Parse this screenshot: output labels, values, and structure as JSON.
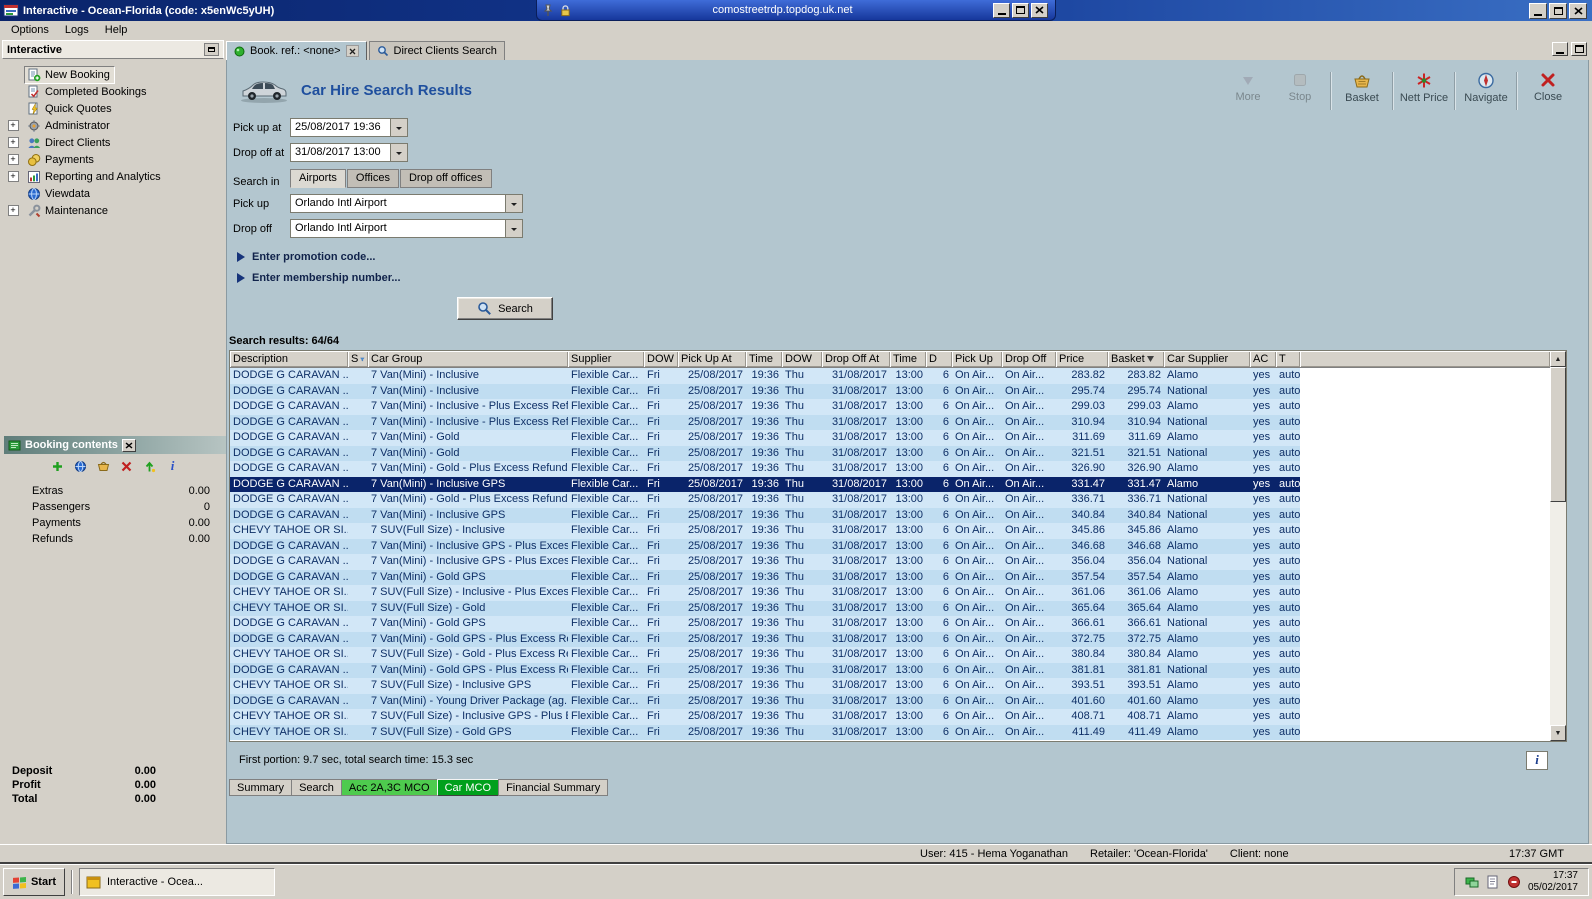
{
  "titlebar": {
    "title": "Interactive - Ocean-Florida (code: x5enWc5yUH)"
  },
  "rdp_bar": {
    "title": "comostreetrdp.topdog.uk.net"
  },
  "menu": {
    "items": [
      "Options",
      "Logs",
      "Help"
    ]
  },
  "sidebar": {
    "title": "Interactive",
    "items": [
      {
        "label": "New Booking"
      },
      {
        "label": "Completed Bookings"
      },
      {
        "label": "Quick Quotes"
      },
      {
        "label": "Administrator"
      },
      {
        "label": "Direct Clients"
      },
      {
        "label": "Payments"
      },
      {
        "label": "Reporting and Analytics"
      },
      {
        "label": "Viewdata"
      },
      {
        "label": "Maintenance"
      }
    ]
  },
  "booking_panel": {
    "title": "Booking contents",
    "rows": [
      {
        "label": "Extras",
        "value": "0.00"
      },
      {
        "label": "Passengers",
        "value": "0"
      },
      {
        "label": "Payments",
        "value": "0.00"
      },
      {
        "label": "Refunds",
        "value": "0.00"
      }
    ],
    "totals": [
      {
        "label": "Deposit",
        "value": "0.00"
      },
      {
        "label": "Profit",
        "value": "0.00"
      },
      {
        "label": "Total",
        "value": "0.00"
      }
    ]
  },
  "tabs": {
    "booking_tab": "Book. ref.: <none>",
    "clients_tab": "Direct Clients Search"
  },
  "main": {
    "title": "Car Hire Search Results",
    "toolbar": [
      {
        "label": "More"
      },
      {
        "label": "Stop"
      },
      {
        "label": "Basket"
      },
      {
        "label": "Nett Price"
      },
      {
        "label": "Navigate"
      },
      {
        "label": "Close"
      }
    ],
    "form": {
      "pickup_at": {
        "label": "Pick up at",
        "value": "25/08/2017 19:36"
      },
      "dropoff_at": {
        "label": "Drop off at",
        "value": "31/08/2017 13:00"
      },
      "search_in_label": "Search in",
      "search_in_tabs": [
        "Airports",
        "Offices",
        "Drop off offices"
      ],
      "pickup": {
        "label": "Pick up",
        "value": "Orlando Intl Airport"
      },
      "dropoff": {
        "label": "Drop off",
        "value": "Orlando Intl Airport"
      },
      "promo": "Enter promotion code...",
      "membership": "Enter membership number...",
      "search_button": "Search"
    },
    "results_label": "Search results: 64/64",
    "table": {
      "columns": [
        "Description",
        "S",
        "Car Group",
        "Supplier",
        "DOW",
        "Pick Up At",
        "Time",
        "DOW",
        "Drop Off At",
        "Time",
        "D",
        "Pick Up",
        "Drop Off",
        "Price",
        "Basket",
        "Car Supplier",
        "AC",
        "T"
      ],
      "row_common": {
        "supplier": "Flexible Car...",
        "dow1": "Fri",
        "pu_date": "25/08/2017",
        "pu_time": "19:36",
        "dow2": "Thu",
        "do_date": "31/08/2017",
        "do_time": "13:00",
        "days": "6",
        "pu_loc": "On Air...",
        "do_loc": "On Air...",
        "ac": "yes",
        "t": "auto"
      },
      "rows": [
        {
          "desc": "DODGE G CARAVAN ...",
          "group": "7 Van(Mini) - Inclusive",
          "price": "283.82",
          "basket": "283.82",
          "car_supplier": "Alamo"
        },
        {
          "desc": "DODGE G CARAVAN ...",
          "group": "7 Van(Mini) - Inclusive",
          "price": "295.74",
          "basket": "295.74",
          "car_supplier": "National"
        },
        {
          "desc": "DODGE G CARAVAN ...",
          "group": "7 Van(Mini) - Inclusive - Plus Excess Ref...",
          "price": "299.03",
          "basket": "299.03",
          "car_supplier": "Alamo"
        },
        {
          "desc": "DODGE G CARAVAN ...",
          "group": "7 Van(Mini) - Inclusive - Plus Excess Ref...",
          "price": "310.94",
          "basket": "310.94",
          "car_supplier": "National"
        },
        {
          "desc": "DODGE G CARAVAN ...",
          "group": "7 Van(Mini) - Gold",
          "price": "311.69",
          "basket": "311.69",
          "car_supplier": "Alamo"
        },
        {
          "desc": "DODGE G CARAVAN ...",
          "group": "7 Van(Mini) - Gold",
          "price": "321.51",
          "basket": "321.51",
          "car_supplier": "National"
        },
        {
          "desc": "DODGE G CARAVAN ...",
          "group": "7 Van(Mini) - Gold - Plus Excess Refund",
          "price": "326.90",
          "basket": "326.90",
          "car_supplier": "Alamo"
        },
        {
          "desc": "DODGE G CARAVAN ...",
          "group": "7 Van(Mini) - Inclusive GPS",
          "price": "331.47",
          "basket": "331.47",
          "car_supplier": "Alamo",
          "selected": true
        },
        {
          "desc": "DODGE G CARAVAN ...",
          "group": "7 Van(Mini) - Gold - Plus Excess Refund",
          "price": "336.71",
          "basket": "336.71",
          "car_supplier": "National"
        },
        {
          "desc": "DODGE G CARAVAN ...",
          "group": "7 Van(Mini) - Inclusive GPS",
          "price": "340.84",
          "basket": "340.84",
          "car_supplier": "National"
        },
        {
          "desc": "CHEVY TAHOE OR SI...",
          "group": "7 SUV(Full Size) - Inclusive",
          "price": "345.86",
          "basket": "345.86",
          "car_supplier": "Alamo"
        },
        {
          "desc": "DODGE G CARAVAN ...",
          "group": "7 Van(Mini) - Inclusive GPS - Plus Exces...",
          "price": "346.68",
          "basket": "346.68",
          "car_supplier": "Alamo"
        },
        {
          "desc": "DODGE G CARAVAN ...",
          "group": "7 Van(Mini) - Inclusive GPS - Plus Exces...",
          "price": "356.04",
          "basket": "356.04",
          "car_supplier": "National"
        },
        {
          "desc": "DODGE G CARAVAN ...",
          "group": "7 Van(Mini) - Gold GPS",
          "price": "357.54",
          "basket": "357.54",
          "car_supplier": "Alamo"
        },
        {
          "desc": "CHEVY TAHOE OR SI...",
          "group": "7 SUV(Full Size) - Inclusive - Plus Excess...",
          "price": "361.06",
          "basket": "361.06",
          "car_supplier": "Alamo"
        },
        {
          "desc": "CHEVY TAHOE OR SI...",
          "group": "7 SUV(Full Size) - Gold",
          "price": "365.64",
          "basket": "365.64",
          "car_supplier": "Alamo"
        },
        {
          "desc": "DODGE G CARAVAN ...",
          "group": "7 Van(Mini) - Gold GPS",
          "price": "366.61",
          "basket": "366.61",
          "car_supplier": "National"
        },
        {
          "desc": "DODGE G CARAVAN ...",
          "group": "7 Van(Mini) - Gold GPS - Plus Excess Ref...",
          "price": "372.75",
          "basket": "372.75",
          "car_supplier": "Alamo"
        },
        {
          "desc": "CHEVY TAHOE OR SI...",
          "group": "7 SUV(Full Size) - Gold - Plus Excess Ref...",
          "price": "380.84",
          "basket": "380.84",
          "car_supplier": "Alamo"
        },
        {
          "desc": "DODGE G CARAVAN ...",
          "group": "7 Van(Mini) - Gold GPS - Plus Excess Ref...",
          "price": "381.81",
          "basket": "381.81",
          "car_supplier": "National"
        },
        {
          "desc": "CHEVY TAHOE OR SI...",
          "group": "7 SUV(Full Size) - Inclusive GPS",
          "price": "393.51",
          "basket": "393.51",
          "car_supplier": "Alamo"
        },
        {
          "desc": "DODGE G CARAVAN ...",
          "group": "7 Van(Mini) - Young Driver Package (ag...",
          "price": "401.60",
          "basket": "401.60",
          "car_supplier": "Alamo"
        },
        {
          "desc": "CHEVY TAHOE OR SI...",
          "group": "7 SUV(Full Size) - Inclusive GPS - Plus E...",
          "price": "408.71",
          "basket": "408.71",
          "car_supplier": "Alamo"
        },
        {
          "desc": "CHEVY TAHOE OR SI...",
          "group": "7 SUV(Full Size) - Gold GPS",
          "price": "411.49",
          "basket": "411.49",
          "car_supplier": "Alamo"
        }
      ]
    },
    "status_text": "First portion: 9.7 sec, total search time: 15.3 sec",
    "bottom_tabs": [
      "Summary",
      "Search",
      "Acc 2A,3C MCO",
      "Car MCO",
      "Financial Summary"
    ]
  },
  "statusbar": {
    "user": "User: 415 - Hema Yoganathan",
    "retailer": "Retailer: 'Ocean-Florida'",
    "client": "Client: none",
    "time": "17:37 GMT"
  },
  "taskbar": {
    "start": "Start",
    "task": "Interactive - Ocea...",
    "clock_time": "17:37",
    "clock_date": "05/02/2017"
  },
  "colors": {
    "selected_row": "#0a246a",
    "row_stripe_light": "#d2e7f7",
    "row_stripe_dark": "#c0ddf1",
    "page_title_blue": "#1f4f9e",
    "content_background": "#b3c6cf",
    "tab_green_light": "#4ecb4e",
    "tab_green_dark": "#00a01c"
  }
}
